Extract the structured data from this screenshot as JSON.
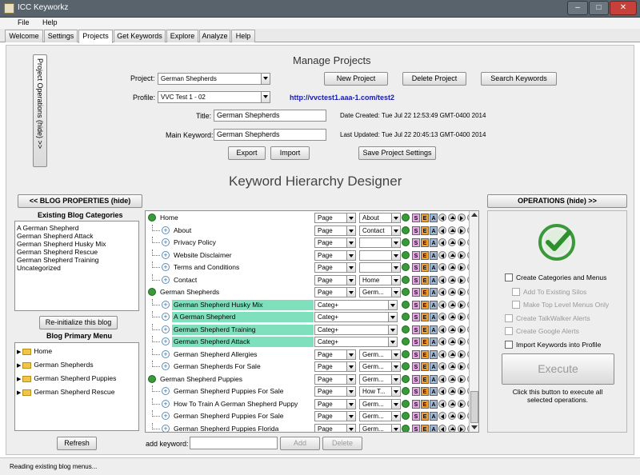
{
  "window": {
    "title": "ICC Keyworkz"
  },
  "menu": [
    "File",
    "Help"
  ],
  "tabs": [
    "Welcome",
    "Settings",
    "Projects",
    "Get Keywords",
    "Explore",
    "Analyze",
    "Help"
  ],
  "side_tab": "Project Operations (hide) >>",
  "manage": {
    "heading": "Manage Projects",
    "project_label": "Project:",
    "project_value": "German Shepherds",
    "profile_label": "Profile:",
    "profile_value": "VVC Test 1 - 02",
    "profile_url": "http://vvctest1.aaa-1.com/test2",
    "new_project": "New Project",
    "delete_project": "Delete Project",
    "search_keywords": "Search Keywords",
    "title_label": "Title:",
    "title_value": "German Shepherds",
    "main_keyword_label": "Main Keyword:",
    "main_keyword_value": "German Shepherds",
    "date_created_label": "Date Created:",
    "date_created": "Tue Jul 22 12:53:49 GMT-0400 2014",
    "last_updated_label": "Last Updated:",
    "last_updated": "Tue Jul 22 20:45:13 GMT-0400 2014",
    "export": "Export",
    "import": "Import",
    "save_settings": "Save Project Settings"
  },
  "designer_heading": "Keyword Hierarchy Designer",
  "blog": {
    "toggle": "<< BLOG PROPERTIES (hide)",
    "categories_title": "Existing Blog Categories",
    "categories": [
      "A German Shepherd",
      "German Shepherd Attack",
      "German Shepherd Husky Mix",
      "German Shepherd Rescue",
      "German Shepherd Training",
      "Uncategorized"
    ],
    "reinit": "Re-initialize this blog",
    "menu_title": "Blog Primary Menu",
    "menu_items": [
      "Home",
      "German Shepherds",
      "German Shepherd Puppies",
      "German Shepherd Rescue"
    ],
    "refresh": "Refresh"
  },
  "hierarchy": {
    "rows": [
      {
        "label": "Home",
        "level": 0,
        "type": "Page",
        "extra": "About"
      },
      {
        "label": "About",
        "level": 1,
        "type": "Page",
        "extra": "Contact"
      },
      {
        "label": "Privacy Policy",
        "level": 1,
        "type": "Page",
        "extra": ""
      },
      {
        "label": "Website Disclaimer",
        "level": 1,
        "type": "Page",
        "extra": ""
      },
      {
        "label": "Terms and Conditions",
        "level": 1,
        "type": "Page",
        "extra": ""
      },
      {
        "label": "Contact",
        "level": 1,
        "type": "Page",
        "extra": "Home"
      },
      {
        "label": "German Shepherds",
        "level": 0,
        "type": "Page",
        "extra": "Germ..."
      },
      {
        "label": "German Shepherd Husky Mix",
        "level": 1,
        "type": "Categ+",
        "extra": "",
        "selected": true
      },
      {
        "label": "A German Shepherd",
        "level": 1,
        "type": "Categ+",
        "extra": "",
        "selected": true
      },
      {
        "label": "German Shepherd Training",
        "level": 1,
        "type": "Categ+",
        "extra": "",
        "selected": true
      },
      {
        "label": "German Shepherd Attack",
        "level": 1,
        "type": "Categ+",
        "extra": "",
        "selected": true
      },
      {
        "label": "German Shepherd Allergies",
        "level": 1,
        "type": "Page",
        "extra": "Germ..."
      },
      {
        "label": "German Shepherds For Sale",
        "level": 1,
        "type": "Page",
        "extra": "Germ..."
      },
      {
        "label": "German Shepherd Puppies",
        "level": 0,
        "type": "Page",
        "extra": "Germ..."
      },
      {
        "label": "German Shepherd Puppies For Sale",
        "level": 1,
        "type": "Page",
        "extra": "How T..."
      },
      {
        "label": "How To Train A German Shepherd Puppy",
        "level": 1,
        "type": "Page",
        "extra": "Germ..."
      },
      {
        "label": "German Shepherd Puppies For Sale",
        "level": 1,
        "type": "Page",
        "extra": "Germ..."
      },
      {
        "label": "German Shepherd Puppies Florida",
        "level": 1,
        "type": "Page",
        "extra": "Germ..."
      }
    ],
    "icons": [
      "S",
      "E",
      "A"
    ],
    "add_keyword_label": "add keyword:",
    "add": "Add",
    "delete": "Delete"
  },
  "operations": {
    "toggle": "OPERATIONS (hide) >>",
    "options": [
      {
        "label": "Create Categories and Menus",
        "enabled": true,
        "indent": false
      },
      {
        "label": "Add To Existing Silos",
        "enabled": false,
        "indent": true
      },
      {
        "label": "Make Top Level Menus Only",
        "enabled": false,
        "indent": true
      },
      {
        "label": "Create TalkWalker Alerts",
        "enabled": false,
        "indent": false
      },
      {
        "label": "Create Google Alerts",
        "enabled": false,
        "indent": false
      },
      {
        "label": "Import Keywords into Profile",
        "enabled": true,
        "indent": false
      }
    ],
    "execute": "Execute",
    "execute_note": "Click this button to execute all selected operations."
  },
  "status": "Reading existing blog menus..."
}
